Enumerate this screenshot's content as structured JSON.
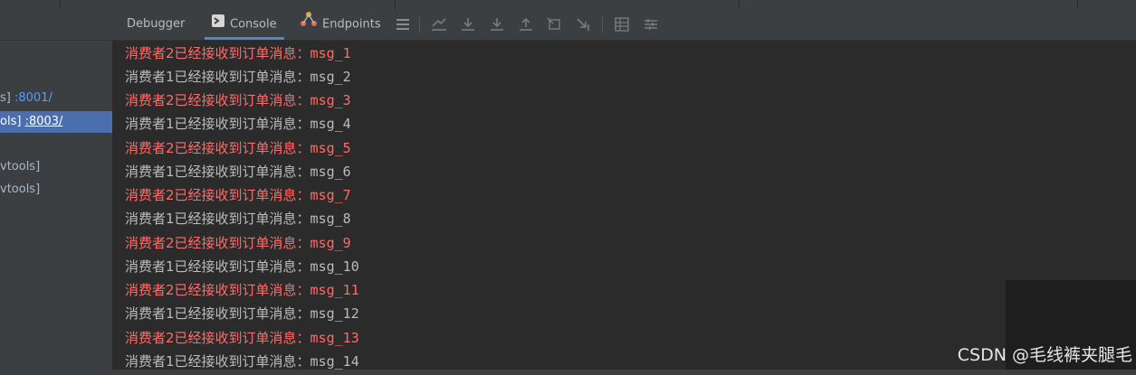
{
  "toolbar": {
    "tabs": [
      {
        "label": "Debugger",
        "active": false
      },
      {
        "label": "Console",
        "active": true
      },
      {
        "label": "Endpoints",
        "active": false
      }
    ],
    "buttons": [
      "menu-icon",
      "show-execution-point-icon",
      "step-over-icon",
      "step-into-icon",
      "step-out-icon",
      "drop-frame-icon",
      "run-to-cursor-icon",
      "evaluate-expression-icon",
      "trace-icon"
    ]
  },
  "services": {
    "items": [
      {
        "prefix": "s]",
        "port": ":8001/",
        "selected": false
      },
      {
        "prefix": "ols]",
        "port": ":8003/",
        "selected": true
      },
      {
        "prefix": "vtools]",
        "port": "",
        "selected": false
      },
      {
        "prefix": "vtools]",
        "port": "",
        "selected": false
      }
    ]
  },
  "console": {
    "lines": [
      {
        "text": "消费者2已经接收到订单消息：",
        "msg": "msg_1",
        "color": "#ff6b68"
      },
      {
        "text": "消费者1已经接收到订单消息：",
        "msg": "msg_2",
        "color": "#bbbbbb"
      },
      {
        "text": "消费者2已经接收到订单消息：",
        "msg": "msg_3",
        "color": "#ff6b68"
      },
      {
        "text": "消费者1已经接收到订单消息：",
        "msg": "msg_4",
        "color": "#bbbbbb"
      },
      {
        "text": "消费者2已经接收到订单消息：",
        "msg": "msg_5",
        "color": "#ff6b68"
      },
      {
        "text": "消费者1已经接收到订单消息：",
        "msg": "msg_6",
        "color": "#bbbbbb"
      },
      {
        "text": "消费者2已经接收到订单消息：",
        "msg": "msg_7",
        "color": "#ff6b68"
      },
      {
        "text": "消费者1已经接收到订单消息：",
        "msg": "msg_8",
        "color": "#bbbbbb"
      },
      {
        "text": "消费者2已经接收到订单消息：",
        "msg": "msg_9",
        "color": "#ff6b68"
      },
      {
        "text": "消费者1已经接收到订单消息：",
        "msg": "msg_10",
        "color": "#bbbbbb"
      },
      {
        "text": "消费者2已经接收到订单消息：",
        "msg": "msg_11",
        "color": "#ff6b68"
      },
      {
        "text": "消费者1已经接收到订单消息：",
        "msg": "msg_12",
        "color": "#bbbbbb"
      },
      {
        "text": "消费者2已经接收到订单消息：",
        "msg": "msg_13",
        "color": "#ff6b68"
      },
      {
        "text": "消费者1已经接收到订单消息：",
        "msg": "msg_14",
        "color": "#bbbbbb"
      }
    ]
  },
  "watermark": {
    "text": "CSDN @毛线裤夹腿毛"
  },
  "colors": {
    "error_red": "#ff6b68",
    "normal_gray": "#bbbbbb",
    "link_blue": "#589df6",
    "selection": "#4b6eaf",
    "panel_bg": "#3c3f41",
    "console_bg": "#2b2b2b"
  }
}
